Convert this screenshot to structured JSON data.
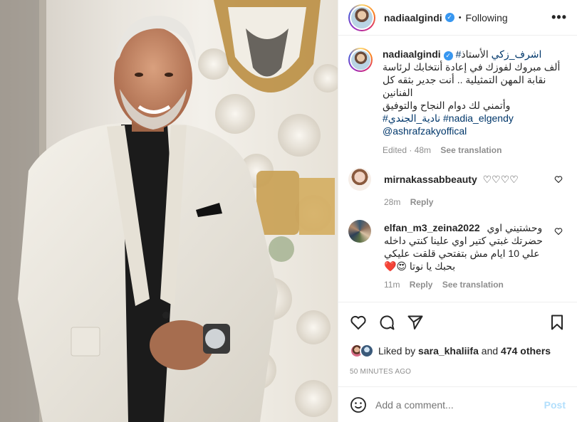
{
  "post": {
    "username": "nadiaalgindi",
    "following_label": "Following",
    "more_label": "•••"
  },
  "caption": {
    "username": "nadiaalgindi",
    "prefix": "الأستاذ",
    "hashtag_name": "#اشرف_زكي",
    "line2": "ألف مبروك لفوزك في إعادة أنتخابك لرئاسة",
    "line3": "نقابة المهن التمثيلية .. أنت جدير بثقه كل الفنانين",
    "line4": "وأتمني لك دوام النجاح والتوفيق",
    "hashtag_ar": "#نادية_الجندي",
    "hashtag_en": "#nadia_elgendy",
    "mention": "@ashrafzakyoffical",
    "edited": "Edited · 48m",
    "see_translation": "See translation"
  },
  "comments": [
    {
      "username": "mirnakassabbeauty",
      "text": "♡♡♡♡",
      "time": "28m",
      "reply": "Reply"
    },
    {
      "username": "elfan_m3_zeina2022",
      "line1": "وحشتيني اوي",
      "line2": "حضرتك غبتي كتير اوي علينا كنتي داخله",
      "line3": "علي 10 ايام مش بتفتحي قلقت عليكي",
      "line4": "بحبك يا نوتا 😍❤️",
      "time": "11m",
      "reply": "Reply",
      "see_translation": "See translation"
    }
  ],
  "likes": {
    "prefix": "Liked by",
    "user": "sara_khaliifa",
    "middle": "and",
    "count": "474 others"
  },
  "timestamp": "50 MINUTES AGO",
  "composer": {
    "placeholder": "Add a comment...",
    "post_label": "Post"
  },
  "icons": {
    "like": "heart-icon",
    "comment": "comment-icon",
    "share": "paper-plane-icon",
    "save": "bookmark-icon",
    "emoji": "smiley-icon",
    "more": "ellipsis-icon",
    "verified": "verified-badge-icon"
  },
  "colors": {
    "verified": "#3897f0",
    "link": "#00376b",
    "muted": "#8e8e8e",
    "post_disabled": "#b2dffc"
  }
}
